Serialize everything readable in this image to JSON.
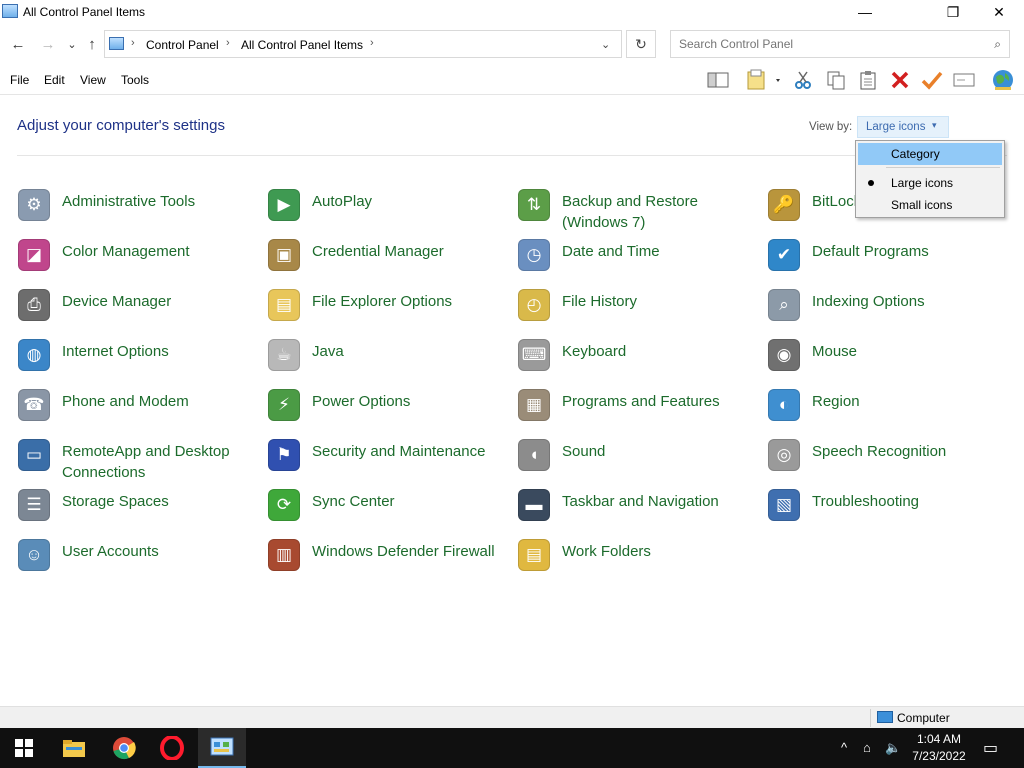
{
  "window": {
    "title": "All Control Panel Items",
    "minimize": "—",
    "maximize": "❐",
    "close": "✕"
  },
  "address": {
    "back": "←",
    "forward": "→",
    "recent": "⌄",
    "up": "↑",
    "separators": [
      "›",
      "›",
      "›"
    ],
    "crumbs": [
      "Control Panel",
      "All Control Panel Items"
    ],
    "dropdown": "⌄",
    "refresh": "↻"
  },
  "search": {
    "placeholder": "Search Control Panel",
    "icon": "⌕"
  },
  "menu": [
    "File",
    "Edit",
    "View",
    "Tools"
  ],
  "toolbar": {
    "icons": [
      "preview-pane-icon",
      "properties-icon",
      "cut-icon",
      "copy-icon",
      "paste-icon",
      "delete-icon",
      "check-icon",
      "rename-icon",
      "globe-icon"
    ]
  },
  "heading": "Adjust your computer's settings",
  "view_by": {
    "label": "View by:",
    "value": "Large icons",
    "caret": "▾"
  },
  "dropdown": {
    "options": [
      "Category",
      "Large icons",
      "Small icons"
    ],
    "highlighted": "Category",
    "selected": "Large icons"
  },
  "items": [
    {
      "label": "Administrative Tools",
      "glyph": "⚙",
      "color": "#8a9bb0"
    },
    {
      "label": "AutoPlay",
      "glyph": "▶",
      "color": "#3f9a52"
    },
    {
      "label": "Backup and Restore (Windows 7)",
      "glyph": "⇅",
      "color": "#5c9e48"
    },
    {
      "label": "BitLocker Drive Encryption",
      "glyph": "🔑",
      "color": "#b9953c"
    },
    {
      "label": "Color Management",
      "glyph": "◪",
      "color": "#c0468c"
    },
    {
      "label": "Credential Manager",
      "glyph": "▣",
      "color": "#a88848"
    },
    {
      "label": "Date and Time",
      "glyph": "◷",
      "color": "#6a8fc0"
    },
    {
      "label": "Default Programs",
      "glyph": "✔",
      "color": "#2f87c9"
    },
    {
      "label": "Device Manager",
      "glyph": "⎙",
      "color": "#6d6d6d"
    },
    {
      "label": "File Explorer Options",
      "glyph": "▤",
      "color": "#e8c65a"
    },
    {
      "label": "File History",
      "glyph": "◴",
      "color": "#d9b94a"
    },
    {
      "label": "Indexing Options",
      "glyph": "⌕",
      "color": "#8c9aa8"
    },
    {
      "label": "Internet Options",
      "glyph": "◍",
      "color": "#3b86c8"
    },
    {
      "label": "Java",
      "glyph": "☕",
      "color": "#b8b8b8"
    },
    {
      "label": "Keyboard",
      "glyph": "⌨",
      "color": "#9a9a9a"
    },
    {
      "label": "Mouse",
      "glyph": "◉",
      "color": "#707070"
    },
    {
      "label": "Phone and Modem",
      "glyph": "☎",
      "color": "#8a96a6"
    },
    {
      "label": "Power Options",
      "glyph": "⚡",
      "color": "#4b9b45"
    },
    {
      "label": "Programs and Features",
      "glyph": "▦",
      "color": "#9a8c78"
    },
    {
      "label": "Region",
      "glyph": "◐",
      "color": "#3f8fd0"
    },
    {
      "label": "RemoteApp and Desktop Connections",
      "glyph": "▭",
      "color": "#3a6ea8"
    },
    {
      "label": "Security and Maintenance",
      "glyph": "⚑",
      "color": "#3050b0"
    },
    {
      "label": "Sound",
      "glyph": "◖",
      "color": "#8c8c8c"
    },
    {
      "label": "Speech Recognition",
      "glyph": "◎",
      "color": "#9a9a9a"
    },
    {
      "label": "Storage Spaces",
      "glyph": "☰",
      "color": "#7c8794"
    },
    {
      "label": "Sync Center",
      "glyph": "⟳",
      "color": "#3fa83a"
    },
    {
      "label": "Taskbar and Navigation",
      "glyph": "▬",
      "color": "#3a4a5e"
    },
    {
      "label": "Troubleshooting",
      "glyph": "▧",
      "color": "#3f6fb0"
    },
    {
      "label": "User Accounts",
      "glyph": "☺",
      "color": "#5a8cb8"
    },
    {
      "label": "Windows Defender Firewall",
      "glyph": "▥",
      "color": "#a84a30"
    },
    {
      "label": "Work Folders",
      "glyph": "▤",
      "color": "#e0b840"
    }
  ],
  "statusbar": {
    "location": "Computer"
  },
  "taskbar": {
    "apps": [
      "start-icon",
      "file-explorer-icon",
      "chrome-icon",
      "opera-icon",
      "control-panel-icon"
    ],
    "time": "1:04 AM",
    "date": "7/23/2022",
    "tray": {
      "chevron": "^",
      "network": "⌂",
      "volume": "🔈",
      "notifications": "▭"
    }
  }
}
